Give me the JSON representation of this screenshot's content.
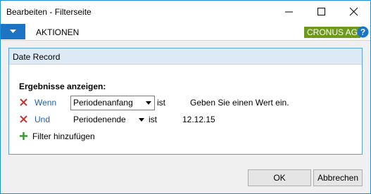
{
  "window": {
    "title": "Bearbeiten - Filterseite"
  },
  "ribbon": {
    "actions_label": "AKTIONEN",
    "company_badge": "CRONUS AG",
    "help_icon": "question-circle-icon",
    "menu_icon": "caret-down-icon"
  },
  "panel": {
    "title": "Date Record",
    "section_label": "Ergebnisse anzeigen:",
    "filters": [
      {
        "connector": "Wenn",
        "field": "Periodenanfang",
        "operator": "ist",
        "value": "Geben Sie einen Wert ein."
      },
      {
        "connector": "Und",
        "field": "Periodenende",
        "operator": "ist",
        "value": "12.12.15"
      }
    ],
    "add_filter_label": "Filter hinzufügen"
  },
  "buttons": {
    "ok": "OK",
    "cancel": "Abbrechen"
  },
  "colors": {
    "accent": "#1d74c4",
    "company_badge": "#6e9a1c",
    "remove_x": "#d1302f",
    "add_plus": "#3a9a3a",
    "link": "#1f5fa8"
  }
}
